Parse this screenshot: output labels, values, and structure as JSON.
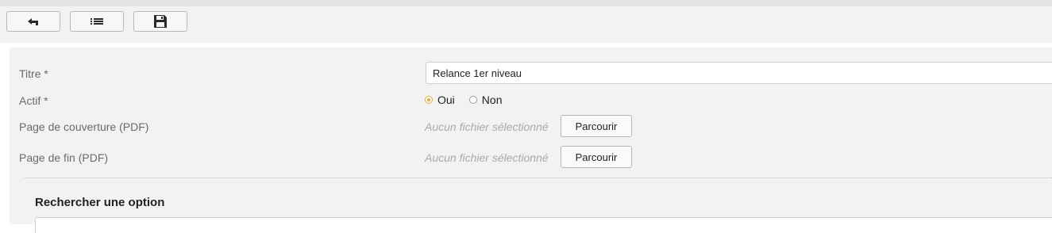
{
  "toolbar": {
    "buttons": [
      {
        "icon": "back-arrow-icon"
      },
      {
        "icon": "list-icon"
      },
      {
        "icon": "save-disk-icon"
      }
    ]
  },
  "form": {
    "titre": {
      "label": "Titre *",
      "value": "Relance 1er niveau"
    },
    "actif": {
      "label": "Actif *",
      "options": [
        {
          "label": "Oui",
          "checked": true
        },
        {
          "label": "Non",
          "checked": false
        }
      ]
    },
    "page_couverture": {
      "label": "Page de couverture (PDF)",
      "file_status": "Aucun fichier sélectionné",
      "browse_label": "Parcourir"
    },
    "page_fin": {
      "label": "Page de fin (PDF)",
      "file_status": "Aucun fichier sélectionné",
      "browse_label": "Parcourir"
    }
  },
  "search_section": {
    "title": "Rechercher une option"
  },
  "colors": {
    "accent_radio": "#e8a33c",
    "panel_bg": "#f2f2f2",
    "label_text": "#6a6a6a",
    "placeholder_text": "#aaaaaa"
  }
}
